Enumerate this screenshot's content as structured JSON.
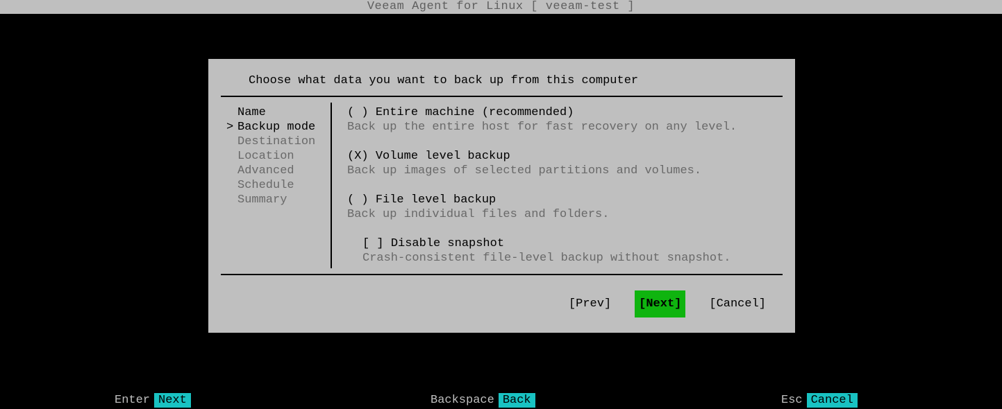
{
  "titlebar": "Veeam Agent for Linux   [ veeam-test ]",
  "dialog": {
    "heading": "Choose what data you want to back up from this computer",
    "nav": {
      "items": [
        {
          "label": "Name",
          "state": "done",
          "caret": ""
        },
        {
          "label": "Backup mode",
          "state": "current",
          "caret": ">"
        },
        {
          "label": "Destination",
          "state": "pending",
          "caret": ""
        },
        {
          "label": "Location",
          "state": "pending",
          "caret": ""
        },
        {
          "label": "Advanced",
          "state": "pending",
          "caret": ""
        },
        {
          "label": "Schedule",
          "state": "pending",
          "caret": ""
        },
        {
          "label": "Summary",
          "state": "pending",
          "caret": ""
        }
      ]
    },
    "options": [
      {
        "mark": "( )",
        "label": "Entire machine (recommended)",
        "desc": "Back up the entire host for fast recovery on any level.",
        "indent": false
      },
      {
        "mark": "(X)",
        "label": "Volume level backup",
        "desc": "Back up images of selected partitions and volumes.",
        "indent": false
      },
      {
        "mark": "( )",
        "label": "File level backup",
        "desc": "Back up individual files and folders.",
        "indent": false
      },
      {
        "mark": "[ ]",
        "label": "Disable snapshot",
        "desc": "Crash-consistent file-level backup without snapshot.",
        "indent": true
      }
    ],
    "buttons": {
      "prev": "[Prev]",
      "next": "[Next]",
      "cancel": "[Cancel]"
    }
  },
  "footer": {
    "left": {
      "key": "Enter",
      "action": "Next"
    },
    "center": {
      "key": "Backspace",
      "action": "Back"
    },
    "right": {
      "key": "Esc",
      "action": "Cancel"
    }
  }
}
